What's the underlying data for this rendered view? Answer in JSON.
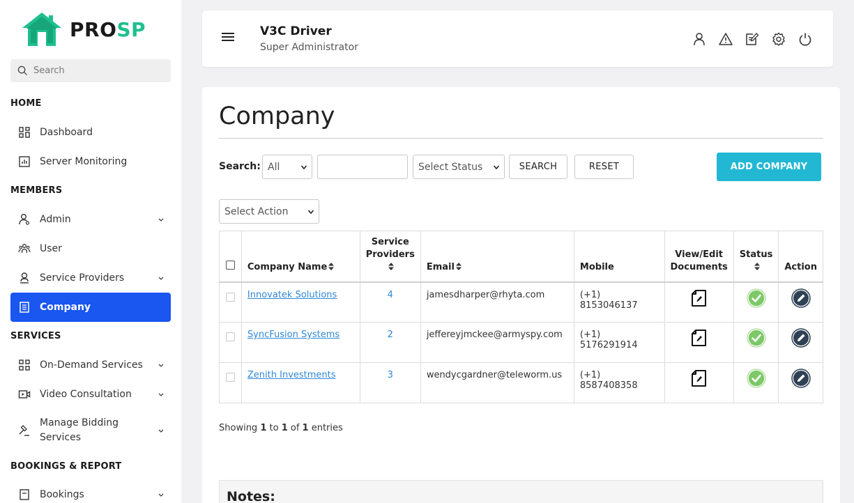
{
  "brand": {
    "logo_text_a": "PRO",
    "logo_text_b": "SP",
    "accent": "#1fbf8f"
  },
  "sidebar": {
    "search_placeholder": "Search",
    "sections": {
      "home": "HOME",
      "members": "MEMBERS",
      "services": "SERVICES",
      "bookings": "BOOKINGS & REPORT"
    },
    "items": {
      "dashboard": "Dashboard",
      "server_monitoring": "Server Monitoring",
      "admin": "Admin",
      "user": "User",
      "service_providers": "Service Providers",
      "company": "Company",
      "on_demand": "On-Demand Services",
      "video": "Video Consultation",
      "bidding_line1": "Manage Bidding",
      "bidding_line2": "Services",
      "bookings": "Bookings"
    },
    "active_color": "#1a56f0"
  },
  "header": {
    "title": "V3C Driver",
    "subtitle": "Super Administrator",
    "icons": [
      "user-icon",
      "alert-icon",
      "edit-note-icon",
      "settings-icon",
      "power-icon"
    ]
  },
  "main": {
    "title": "Company",
    "search_label": "Search:",
    "filter_value": "All",
    "status_placeholder": "Select Status",
    "search_button": "SEARCH",
    "reset_button": "RESET",
    "add_button": "ADD COMPANY",
    "action_select": "Select Action",
    "columns": {
      "company_name": "Company Name",
      "providers_line1": "Service",
      "providers_line2": "Providers",
      "email": "Email",
      "mobile": "Mobile",
      "docs_line1": "View/Edit",
      "docs_line2": "Documents",
      "status": "Status",
      "action": "Action"
    },
    "rows": [
      {
        "name": "Innovatek Solutions",
        "providers": "4",
        "email": "jamesdharper@rhyta.com",
        "mobile": "(+1) 8153046137"
      },
      {
        "name": "SyncFusion Systems",
        "providers": "2",
        "email": "jeffereyjmckee@armyspy.com",
        "mobile": "(+1) 5176291914"
      },
      {
        "name": "Zenith Investments",
        "providers": "3",
        "email": "wendycgardner@teleworm.us",
        "mobile": "(+1) 8587408358"
      }
    ],
    "showing": {
      "prefix": "Showing ",
      "from": "1",
      "to_word": " to ",
      "to": "1",
      "of_word": " of ",
      "total": "1",
      "suffix": " entries"
    },
    "notes_title": "Notes:"
  }
}
